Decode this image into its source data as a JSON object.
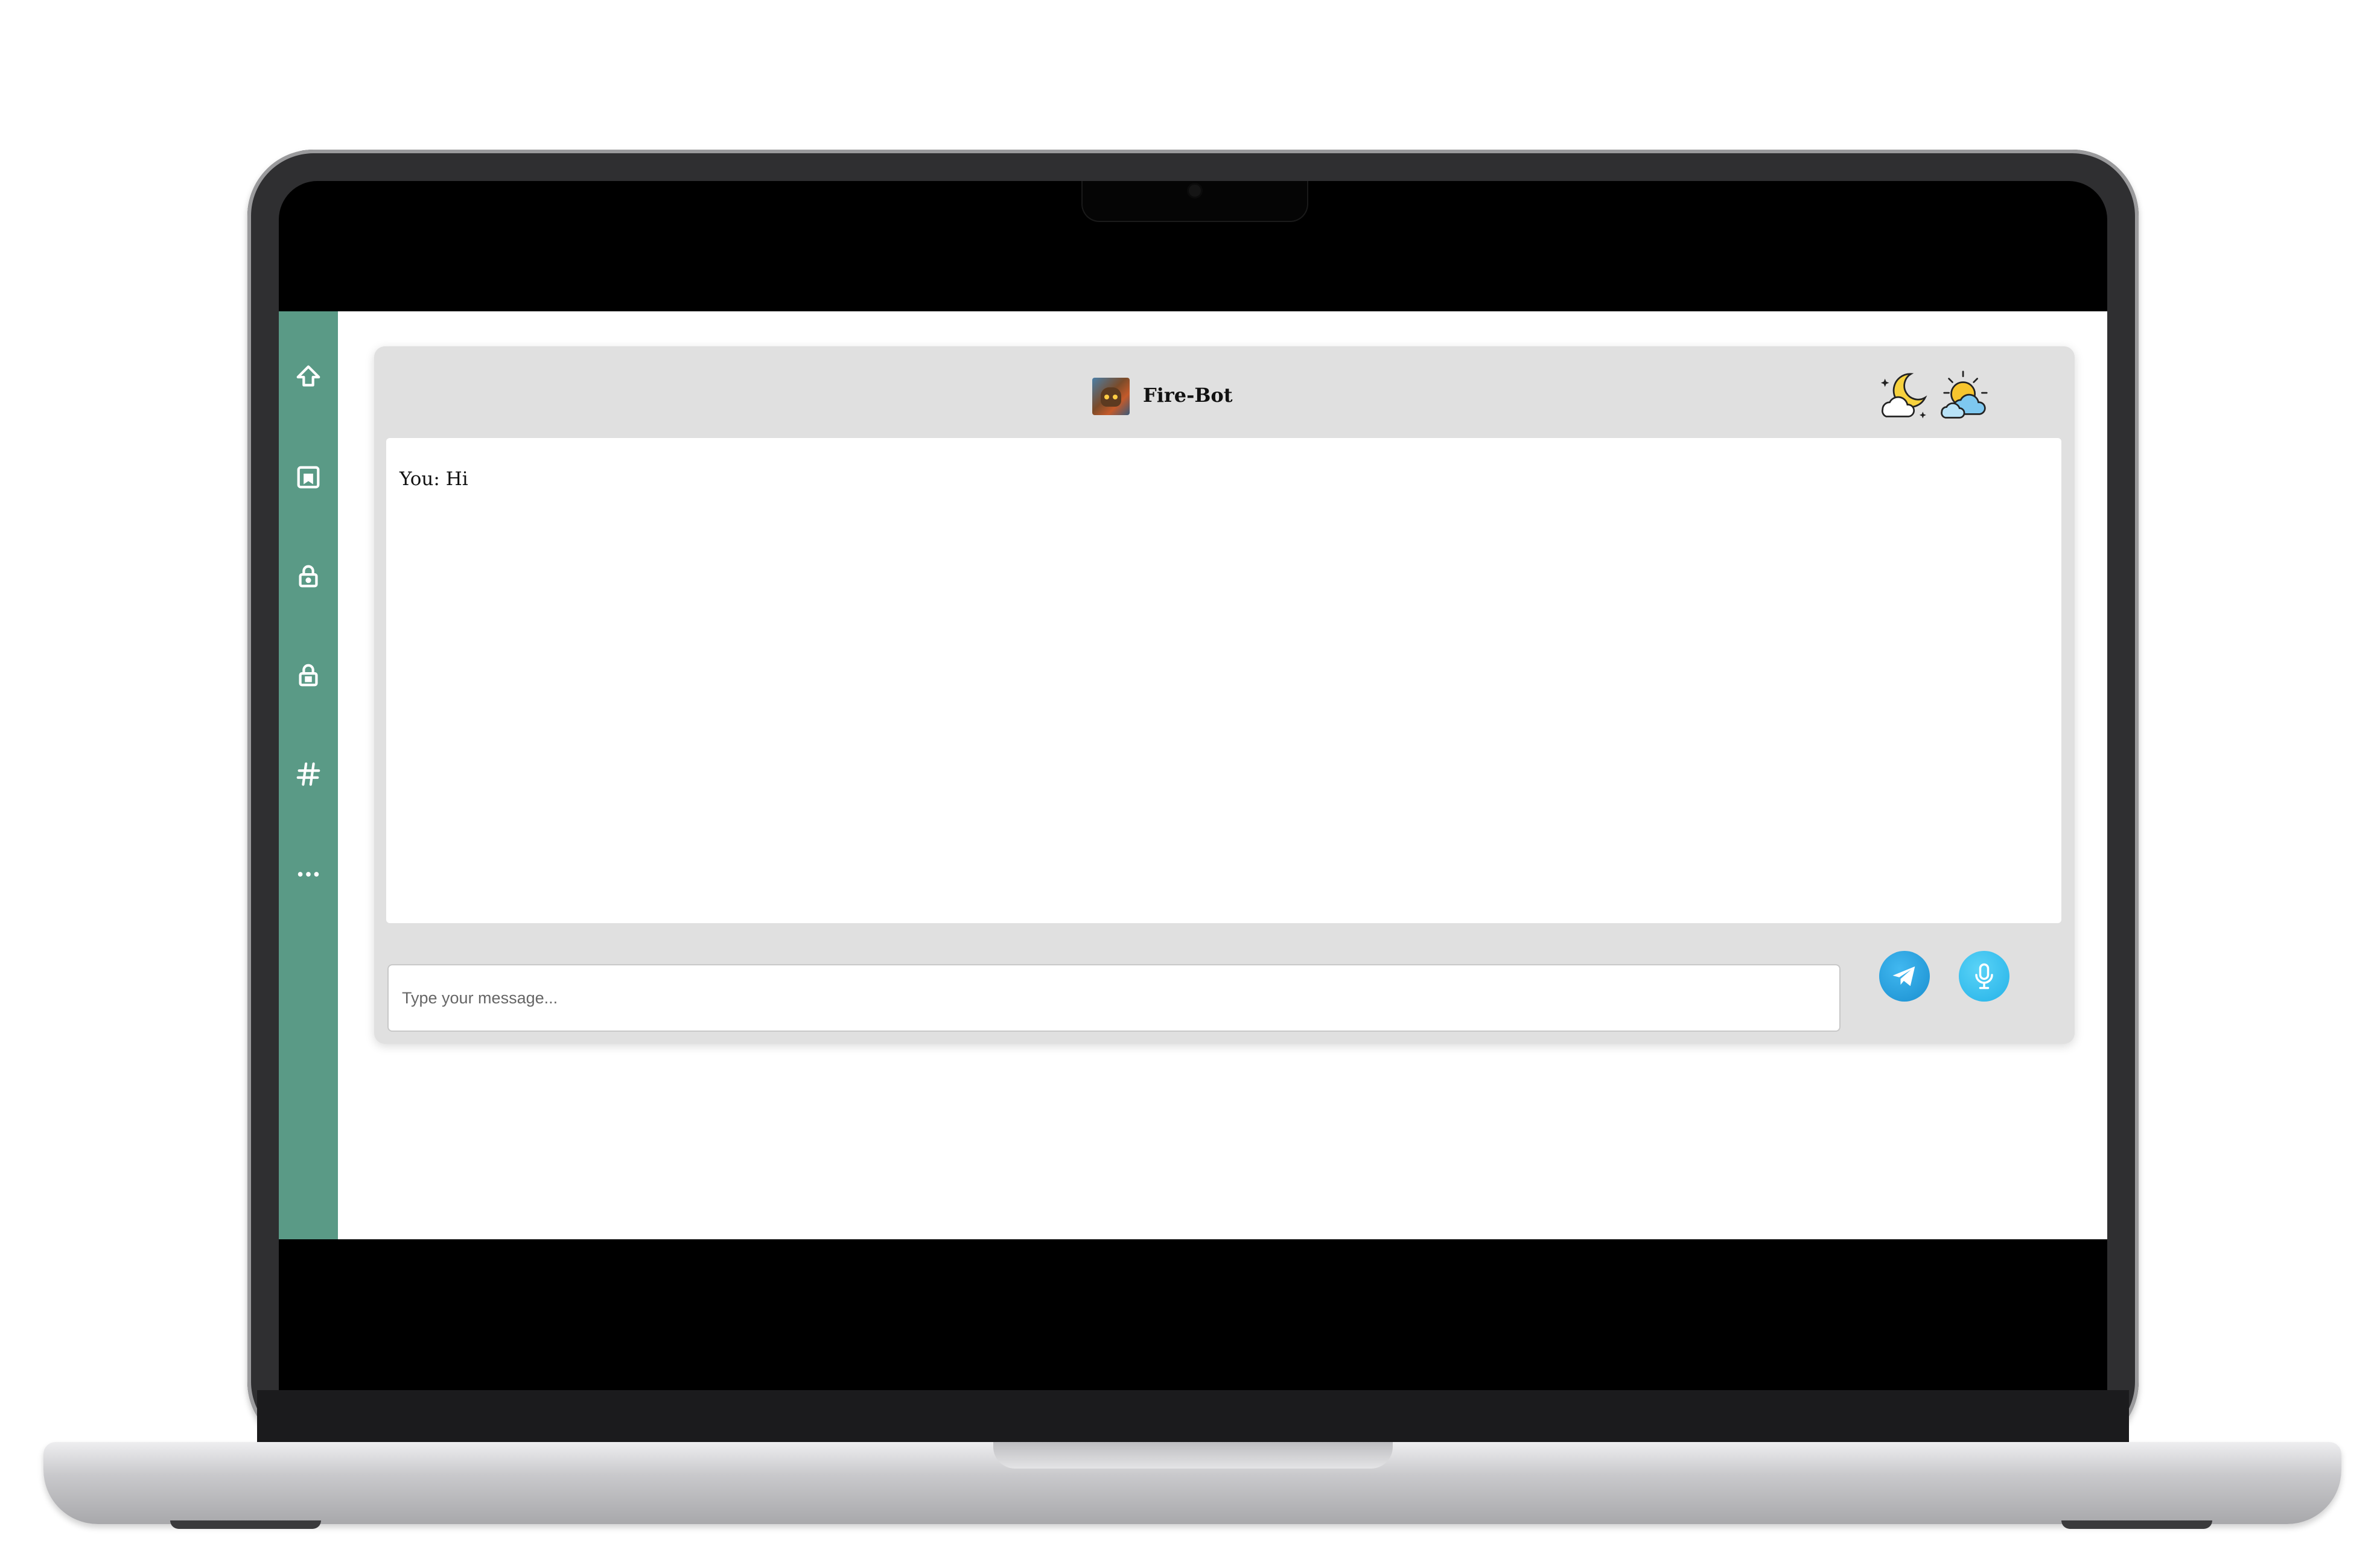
{
  "sidebar": {
    "items": [
      {
        "icon": "upload-arrow-icon"
      },
      {
        "icon": "saved-note-icon"
      },
      {
        "icon": "lock-icon"
      },
      {
        "icon": "lock-filled-icon"
      },
      {
        "icon": "hashtag-icon"
      },
      {
        "icon": "more-dots-icon"
      }
    ],
    "color": "#5a9a86"
  },
  "chat": {
    "bot_name": "Fire-Bot",
    "weather_icons": [
      "night-cloudy-weather-icon",
      "day-cloudy-weather-icon"
    ],
    "messages": [
      {
        "text": "You: Hi"
      }
    ],
    "input": {
      "placeholder": "Type your message...",
      "value": ""
    },
    "send_icon": "paper-plane-icon",
    "mic_icon": "microphone-icon"
  }
}
